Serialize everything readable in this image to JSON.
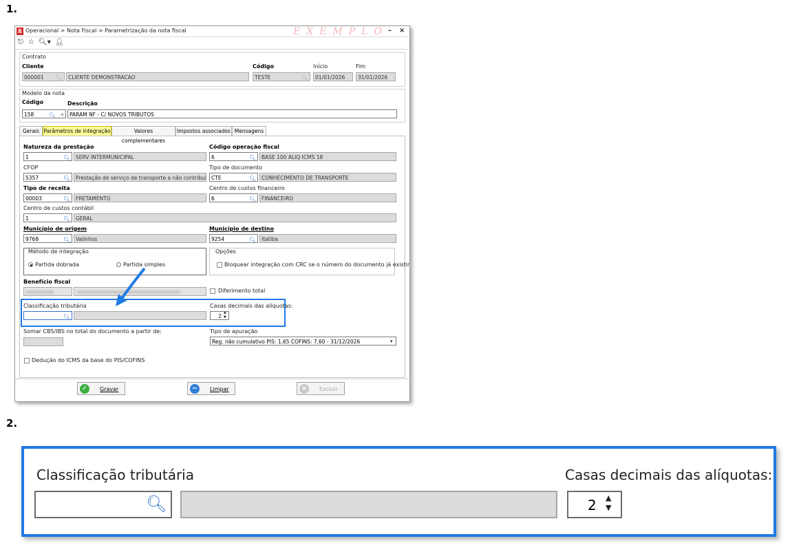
{
  "steps": [
    "1.",
    "2."
  ],
  "window": {
    "breadcrumb": "Operacional > Nota Fiscal > Parametrização da nota fiscal",
    "watermark": "EXEMPLO",
    "app_icon_letter": "ß",
    "minimize": "–",
    "close": "×"
  },
  "contrato": {
    "section_title": "Contrato",
    "cliente_label": "Cliente",
    "cliente_code": "000001",
    "cliente_name": "CLIENTE DEMONSTRACAO",
    "codigo_label": "Código",
    "codigo_value": "TESTE",
    "inicio_label": "Início",
    "inicio_value": "01/01/2026",
    "fim_label": "Fim",
    "fim_value": "31/01/2026"
  },
  "modelo": {
    "section_title": "Modelo da nota",
    "codigo_label": "Código",
    "codigo_value": "158",
    "descricao_label": "Descrição",
    "descricao_value": "PARAM NF - C/ NOVOS TRIBUTOS"
  },
  "tabs": [
    {
      "label": "Gerais",
      "active": false
    },
    {
      "label": "Parâmetros de integração",
      "active": true
    },
    {
      "label": "Valores complementares",
      "active": false
    },
    {
      "label": "Impostos associados",
      "active": false
    },
    {
      "label": "Mensagens",
      "active": false
    }
  ],
  "form": {
    "natureza_label": "Natureza da prestação",
    "natureza_code": "1",
    "natureza_desc": "SERV INTERMUNICIPAL",
    "codop_label": "Código operação fiscal",
    "codop_code": "6",
    "codop_desc": "BASE 100 ALIQ ICMS 18",
    "cfop_label": "CFOP",
    "cfop_code": "5357",
    "cfop_desc": "Prestação de serviço de transporte a não contribuinte",
    "tipodoc_label": "Tipo de documento",
    "tipodoc_code": "CTE",
    "tipodoc_desc": "CONHECIMENTO DE TRANSPORTE",
    "tiporec_label": "Tipo de receita",
    "tiporec_code": "00003",
    "tiporec_desc": "FRETAMENTO",
    "ccfin_label": "Centro de custos financeiro",
    "ccfin_code": "6",
    "ccfin_desc": "FINANCEIRO",
    "cccont_label": "Centro de custos contábil",
    "cccont_code": "1",
    "cccont_desc": "GERAL",
    "munorig_label": "Município de origem",
    "munorig_code": "9768",
    "munorig_desc": "Valinhos",
    "mundest_label": "Município de destino",
    "mundest_code": "9254",
    "mundest_desc": "Itatiba",
    "metodo_title": "Método de integração",
    "metodo_opt1": "Partida dobrada",
    "metodo_opt2": "Partida simples",
    "metodo_selected": "Partida dobrada",
    "opcoes_title": "Opções",
    "opcoes_check": "Bloquear integração com CRC se o número do documento já existir",
    "beneficio_label": "Benefício fiscal",
    "diferimento_label": "Diferimento total",
    "classif_label": "Classificação tributária",
    "casas_label": "Casas decimais das alíquotas:",
    "casas_value": "2",
    "somar_label": "Somar CBS/IBS no total do documento a partir de:",
    "tipoapur_label": "Tipo de apuração",
    "tipoapur_value": "Reg. não cumulativo PIS: 1,65 COFINS: 7,60 - 31/12/2026",
    "deducao_label": "Dedução do ICMS da base do PIS/COFINS"
  },
  "buttons": {
    "gravar": "Gravar",
    "limpar": "Limpar",
    "excluir": "Excluir"
  },
  "zoom": {
    "classif_label": "Classificação tributária",
    "casas_label": "Casas decimais das alíquotas:",
    "casas_value": "2"
  },
  "colors": {
    "highlight": "#1e7ae6",
    "active_tab": "#ffff99",
    "readonly_field": "#dcdcdc"
  }
}
